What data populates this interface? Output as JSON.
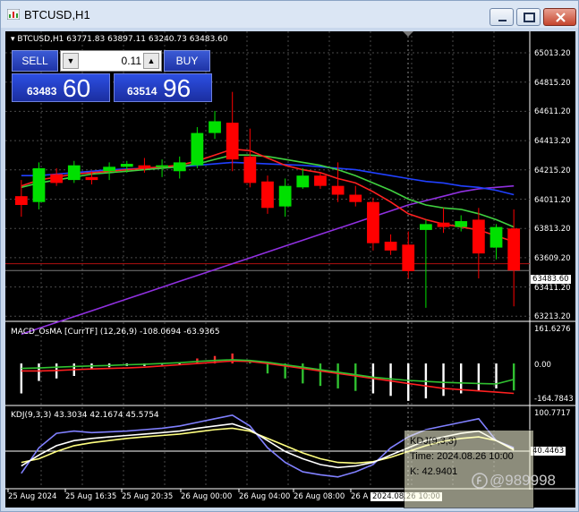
{
  "window": {
    "title": "BTCUSD,H1"
  },
  "chart": {
    "header_symbol": "BTCUSD,H1",
    "header_ohlc": "63771.83 63897.11 63240.73 63483.60",
    "price_axis": [
      "65013.20",
      "64815.20",
      "64611.20",
      "64413.20",
      "64215.20",
      "64011.20",
      "63813.20",
      "63609.20",
      "63411.20",
      "63213.20"
    ],
    "current_price_tag": "63483.60",
    "time_axis": [
      "25 Aug 2024",
      "25 Aug 16:35",
      "25 Aug 20:35",
      "26 Aug 00:00",
      "26 Aug 04:00",
      "26 Aug 08:00",
      "26 A"
    ],
    "time_tag": "2024.08.26 10:00"
  },
  "trade_panel": {
    "sell_label": "SELL",
    "buy_label": "BUY",
    "lot_value": "0.11",
    "sell_price_small": "63483",
    "sell_price_big": "60",
    "buy_price_small": "63514",
    "buy_price_big": "96"
  },
  "macd": {
    "label": "MACD_OsMA [CurrTF] (12,26,9) -108.0694 -63.9365",
    "axis": [
      "161.6276",
      "0.00",
      "-164.7843"
    ]
  },
  "kdj": {
    "label": "KDJ(9,3,3) 43.3034 42.1674 45.5754",
    "axis": [
      "100.7717",
      "40.4463"
    ]
  },
  "tooltip": {
    "line1": "KDJ(9,3,3)",
    "line2": "Time: 2024.08.26 10:00",
    "line3": "K: 42.9401"
  },
  "watermark": "@989998",
  "colors": {
    "bull_candle": "#00e000",
    "bear_candle": "#ff0000",
    "ma_fast": "#ff2020",
    "ma_mid": "#40d040",
    "ma_slow": "#2040ff",
    "ma_long": "#9030e0",
    "trade_blue": "#1f34a6"
  },
  "chart_data": {
    "type": "candlestick",
    "symbol": "BTCUSD",
    "timeframe": "H1",
    "ylim": [
      63150,
      65100
    ],
    "candles": [
      {
        "o": 63990,
        "h": 64100,
        "l": 63850,
        "c": 63930
      },
      {
        "o": 63950,
        "h": 64220,
        "l": 63900,
        "c": 64180
      },
      {
        "o": 64140,
        "h": 64180,
        "l": 64060,
        "c": 64080
      },
      {
        "o": 64100,
        "h": 64230,
        "l": 64080,
        "c": 64200
      },
      {
        "o": 64120,
        "h": 64160,
        "l": 64070,
        "c": 64100
      },
      {
        "o": 64160,
        "h": 64220,
        "l": 64100,
        "c": 64190
      },
      {
        "o": 64190,
        "h": 64230,
        "l": 64150,
        "c": 64210
      },
      {
        "o": 64200,
        "h": 64250,
        "l": 64150,
        "c": 64180
      },
      {
        "o": 64190,
        "h": 64240,
        "l": 64120,
        "c": 64200
      },
      {
        "o": 64160,
        "h": 64260,
        "l": 64110,
        "c": 64220
      },
      {
        "o": 64200,
        "h": 64460,
        "l": 64180,
        "c": 64420
      },
      {
        "o": 64420,
        "h": 64570,
        "l": 64380,
        "c": 64500
      },
      {
        "o": 64490,
        "h": 64700,
        "l": 64160,
        "c": 64240
      },
      {
        "o": 64260,
        "h": 64450,
        "l": 64050,
        "c": 64080
      },
      {
        "o": 64090,
        "h": 64130,
        "l": 63870,
        "c": 63910
      },
      {
        "o": 63920,
        "h": 64110,
        "l": 63850,
        "c": 64060
      },
      {
        "o": 64050,
        "h": 64180,
        "l": 64040,
        "c": 64130
      },
      {
        "o": 64130,
        "h": 64150,
        "l": 64040,
        "c": 64060
      },
      {
        "o": 64060,
        "h": 64220,
        "l": 63950,
        "c": 64000
      },
      {
        "o": 64000,
        "h": 64060,
        "l": 63920,
        "c": 63950
      },
      {
        "o": 63950,
        "h": 63980,
        "l": 63620,
        "c": 63670
      },
      {
        "o": 63680,
        "h": 63730,
        "l": 63590,
        "c": 63620
      },
      {
        "o": 63660,
        "h": 63750,
        "l": 63430,
        "c": 63480
      },
      {
        "o": 63760,
        "h": 63830,
        "l": 63230,
        "c": 63800
      },
      {
        "o": 63810,
        "h": 63910,
        "l": 63740,
        "c": 63780
      },
      {
        "o": 63780,
        "h": 63860,
        "l": 63750,
        "c": 63820
      },
      {
        "o": 63830,
        "h": 63910,
        "l": 63430,
        "c": 63600
      },
      {
        "o": 63640,
        "h": 63800,
        "l": 63560,
        "c": 63780
      },
      {
        "o": 63770,
        "h": 63900,
        "l": 63240,
        "c": 63484
      }
    ],
    "ma_fast": [
      64060,
      64100,
      64120,
      64140,
      64150,
      64160,
      64170,
      64180,
      64190,
      64200,
      64230,
      64270,
      64310,
      64300,
      64250,
      64200,
      64170,
      64150,
      64110,
      64080,
      64020,
      63950,
      63870,
      63830,
      63800,
      63780,
      63760,
      63720,
      63680
    ],
    "ma_mid": [
      64050,
      64080,
      64100,
      64120,
      64140,
      64150,
      64160,
      64170,
      64180,
      64190,
      64210,
      64240,
      64270,
      64270,
      64260,
      64240,
      64220,
      64200,
      64170,
      64130,
      64080,
      64030,
      63970,
      63930,
      63910,
      63900,
      63870,
      63830,
      63780
    ],
    "ma_slow": [
      64130,
      64130,
      64140,
      64150,
      64160,
      64170,
      64175,
      64180,
      64185,
      64190,
      64200,
      64210,
      64220,
      64215,
      64210,
      64205,
      64200,
      64190,
      64180,
      64170,
      64150,
      64130,
      64110,
      64090,
      64080,
      64060,
      64050,
      64030,
      64000
    ],
    "ma_long": [
      63050,
      63090,
      63130,
      63170,
      63210,
      63250,
      63290,
      63330,
      63370,
      63410,
      63450,
      63490,
      63530,
      63570,
      63610,
      63650,
      63690,
      63730,
      63770,
      63810,
      63850,
      63890,
      63930,
      63960,
      63990,
      64020,
      64040,
      64050,
      64060
    ],
    "macd_hist": [
      -120,
      -70,
      -60,
      -50,
      -20,
      -15,
      -10,
      -10,
      -5,
      0,
      20,
      30,
      40,
      5,
      -40,
      -60,
      -80,
      -90,
      -100,
      -110,
      -120,
      -130,
      -150,
      -140,
      -130,
      -120,
      -110,
      -100,
      -108
    ],
    "macd_signal": [
      -30,
      -30,
      -28,
      -25,
      -22,
      -20,
      -18,
      -15,
      -10,
      -5,
      0,
      5,
      10,
      8,
      0,
      -10,
      -20,
      -30,
      -40,
      -50,
      -60,
      -70,
      -80,
      -90,
      -100,
      -105,
      -110,
      -115,
      -120
    ],
    "macd_line": [
      -20,
      -18,
      -15,
      -12,
      -10,
      -8,
      -5,
      -3,
      0,
      3,
      8,
      12,
      15,
      12,
      5,
      -5,
      -15,
      -25,
      -35,
      -45,
      -55,
      -62,
      -68,
      -72,
      -76,
      -78,
      -80,
      -82,
      -63.9
    ],
    "kdj_k": [
      20,
      35,
      48,
      55,
      58,
      60,
      62,
      64,
      66,
      68,
      72,
      75,
      78,
      70,
      55,
      40,
      30,
      22,
      18,
      20,
      25,
      35,
      45,
      55,
      60,
      65,
      68,
      55,
      43
    ],
    "kdj_d": [
      25,
      30,
      40,
      48,
      52,
      55,
      58,
      60,
      62,
      64,
      67,
      70,
      72,
      68,
      58,
      48,
      38,
      30,
      25,
      24,
      26,
      32,
      40,
      48,
      54,
      58,
      60,
      55,
      42
    ],
    "kdj_j": [
      10,
      45,
      65,
      68,
      66,
      67,
      68,
      70,
      72,
      75,
      80,
      85,
      90,
      75,
      45,
      25,
      12,
      8,
      5,
      12,
      22,
      45,
      60,
      70,
      75,
      80,
      85,
      55,
      45
    ]
  }
}
